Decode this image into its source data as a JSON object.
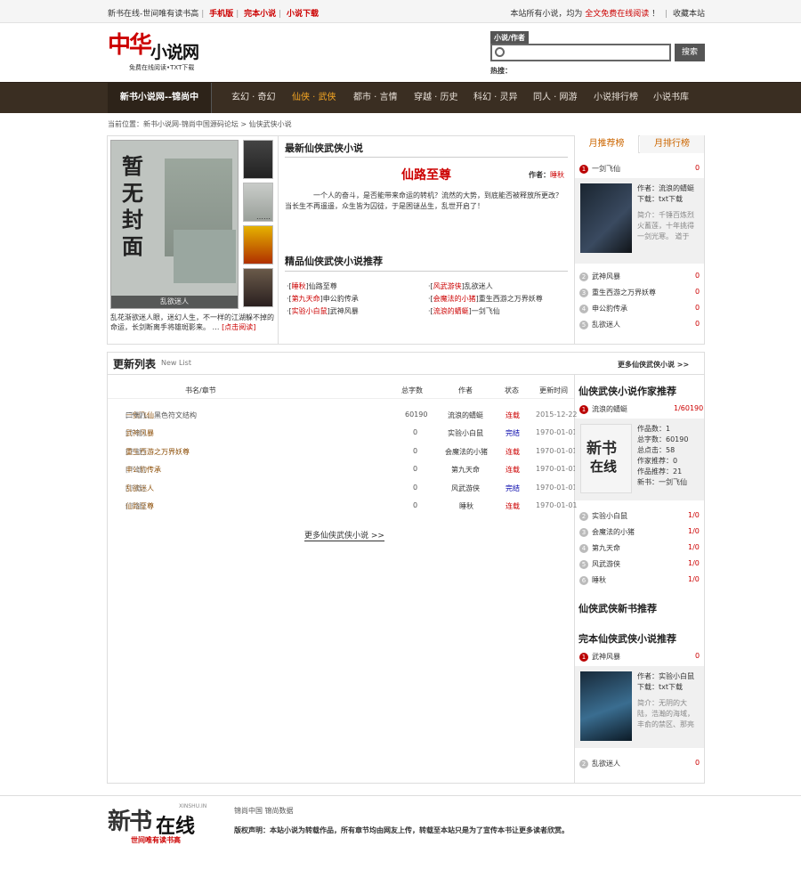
{
  "topbar": {
    "slogan": "新书在线-世间唯有读书高",
    "mobile": "手机版",
    "complete": "完本小说",
    "download": "小说下载",
    "notice_pre": "本站所有小说，均为",
    "notice_red": "全文免费在线阅读",
    "notice_post": "！",
    "bookmark": "收藏本站"
  },
  "logo": {
    "brand_red": "中华",
    "brand_black": "小说网",
    "sub": "免费在线阅读•TXT下载"
  },
  "search": {
    "tab": "小说/作者",
    "button": "搜索",
    "hot_label": "热搜："
  },
  "nav": {
    "home": "新书小说网--锦尚中",
    "items": [
      "玄幻 · 奇幻",
      "仙侠 · 武侠",
      "都市 · 言情",
      "穿越 · 历史",
      "科幻 · 灵异",
      "同人 · 网游",
      "小说排行榜",
      "小说书库"
    ]
  },
  "breadcrumb": "当前位置：新书小说网-锦尚中国源码论坛 > 仙侠武侠小说",
  "featured": {
    "cover_title": "暂无封面",
    "cover_caption": "乱欲迷人",
    "desc": "乱花渐欲迷人眼，迷幻人生，不一样的江湖躲不掉的命运，长剑断离手将雄斑影来。",
    "more_dots": "…",
    "read_link": "[点击阅读]"
  },
  "latest": {
    "heading": "最新仙侠武侠小说",
    "book": "仙路至尊",
    "author_label": "作者：",
    "author": "睡秋",
    "desc": "一个人的奋斗，是否能带来命运的转机？流然的大势，到底能否被释放所更改？当长生不再遥遥，众生皆为囚徒，于是困谜丛生，乱世开启了！",
    "ellipsis": "……"
  },
  "picks": {
    "heading": "精品仙侠武侠小说推荐",
    "items": [
      {
        "author": "睡秋",
        "book": "仙路至尊"
      },
      {
        "author": "风武游侠",
        "book": "乱欲迷人"
      },
      {
        "author": "第九天命",
        "book": "申公豹传承"
      },
      {
        "author": "会魔法的小猪",
        "book": "重生西游之万界妖尊"
      },
      {
        "author": "实验小白鼠",
        "book": "武神风暴"
      },
      {
        "author": "流浪的蜻蜓",
        "book": "一剑飞仙"
      }
    ]
  },
  "monthly": {
    "tab_recommend": "月推荐榜",
    "tab_rank": "月排行榜",
    "first": {
      "name": "一剑飞仙",
      "value": "0"
    },
    "card": {
      "author": "作者：流浪的蜻蜓",
      "download": "下载：txt下载",
      "intro": "简介：千锤百炼烈火蓄莲，十年挑得一剑光寒。 道于"
    },
    "others": [
      {
        "n": "2",
        "name": "武神风暴",
        "value": "0"
      },
      {
        "n": "3",
        "name": "重生西游之万界妖尊",
        "value": "0"
      },
      {
        "n": "4",
        "name": "申公豹传承",
        "value": "0"
      },
      {
        "n": "5",
        "name": "乱欲迷人",
        "value": "0"
      }
    ]
  },
  "updates": {
    "title": "更新列表",
    "title_en": "New List",
    "more_top": "更多仙侠武侠小说  >>",
    "cols": [
      "书名/章节",
      "总字数",
      "作者",
      "状态",
      "更新时间"
    ],
    "rows": [
      {
        "book": "一剑飞仙",
        "dl": "[下载]",
        "chapter": "二十八、黑色符文结构",
        "words": "60190",
        "author": "流浪的蜻蜓",
        "status": "连载",
        "date": "2015-12-22"
      },
      {
        "book": "武神风暴",
        "dl": "[下载]",
        "chapter": "",
        "words": "0",
        "author": "实验小白鼠",
        "status": "完结",
        "date": "1970-01-01"
      },
      {
        "book": "重生西游之万界妖尊",
        "dl": "[下载]",
        "chapter": "",
        "words": "0",
        "author": "会魔法的小猪",
        "status": "连载",
        "date": "1970-01-01"
      },
      {
        "book": "申公豹传承",
        "dl": "[下载]",
        "chapter": "",
        "words": "0",
        "author": "第九天命",
        "status": "连载",
        "date": "1970-01-01"
      },
      {
        "book": "乱欲迷人",
        "dl": "[下载]",
        "chapter": "",
        "words": "0",
        "author": "风武游侠",
        "status": "完结",
        "date": "1970-01-01"
      },
      {
        "book": "仙路至尊",
        "dl": "[下载]",
        "chapter": "",
        "words": "0",
        "author": "睡秋",
        "status": "连载",
        "date": "1970-01-01"
      }
    ],
    "more_bottom": "更多仙侠武侠小说  >>"
  },
  "authors": {
    "heading": "仙侠武侠小说作家推荐",
    "first": {
      "name": "流浪的蜻蜓",
      "value": "1/60190"
    },
    "card": [
      "作品数：1",
      "总字数：60190",
      "总点击：58",
      "作家推荐：0",
      "作品推荐：21",
      "新书：一剑飞仙"
    ],
    "others": [
      {
        "n": "2",
        "name": "实验小白鼠",
        "value": "1/0"
      },
      {
        "n": "3",
        "name": "会魔法的小猪",
        "value": "1/0"
      },
      {
        "n": "4",
        "name": "第九天命",
        "value": "1/0"
      },
      {
        "n": "5",
        "name": "风武游侠",
        "value": "1/0"
      },
      {
        "n": "6",
        "name": "睡秋",
        "value": "1/0"
      }
    ]
  },
  "newbooks": {
    "heading": "仙侠武侠新书推荐"
  },
  "complete_rec": {
    "heading": "完本仙侠武侠小说推荐",
    "first": {
      "name": "武神风暴",
      "value": "0"
    },
    "card": {
      "author": "作者：实验小白鼠",
      "download": "下载：txt下载",
      "intro": "简介：无阴的大陆，浩瀚的海域，丰俞的禁区、那亮"
    },
    "second": {
      "n": "2",
      "name": "乱欲迷人",
      "value": "0"
    }
  },
  "footer": {
    "logo_a": "新书",
    "logo_b": "在线",
    "logo_en": "XINSHU.IN",
    "logo_slogan": "世间唯有读书高",
    "links": "锦尚中国   锦尚数据",
    "copyright": "版权声明：本站小说为转载作品，所有章节均由网友上传，转载至本站只是为了宣传本书让更多读者欣赏。"
  },
  "colors": {
    "accent": "#cc0000",
    "nav_bg": "#3a2e22",
    "active_nav": "#f5a623"
  }
}
